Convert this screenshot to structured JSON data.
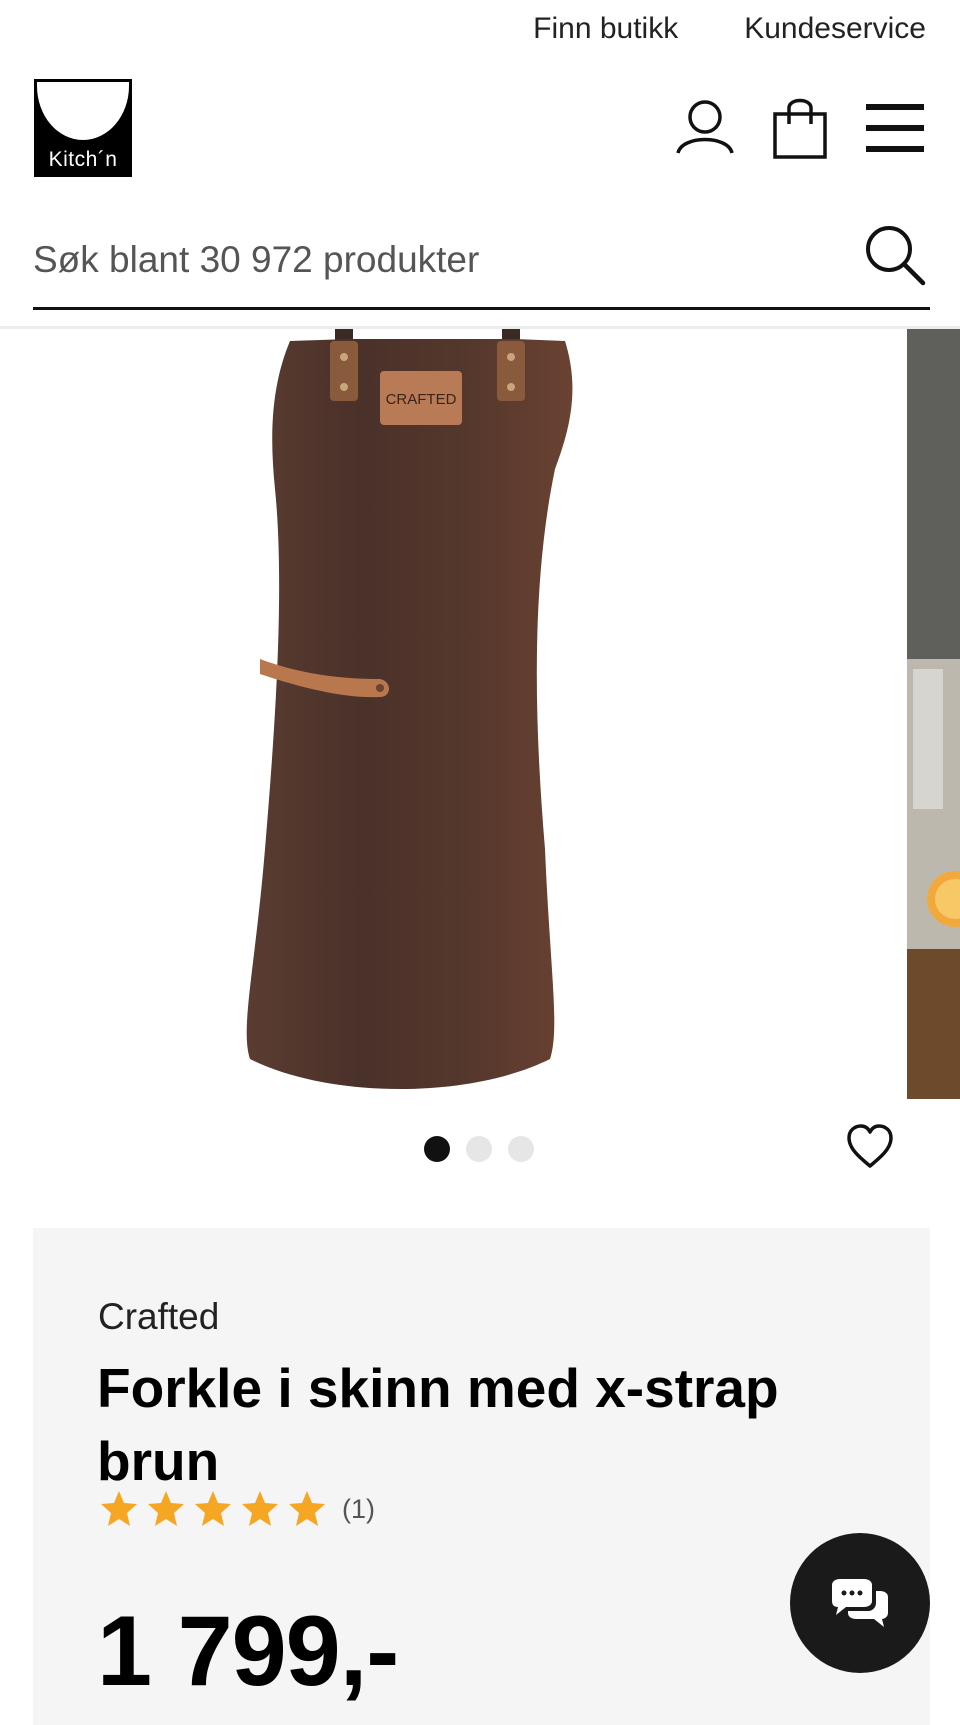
{
  "top_links": [
    "Finn butikk",
    "Kundeservice"
  ],
  "logo": {
    "text": "Kitch´n"
  },
  "header": {
    "icons": [
      "user-icon",
      "shopping-bag-icon",
      "menu-icon"
    ]
  },
  "search": {
    "placeholder": "Søk blant 30 972 produkter",
    "value": ""
  },
  "gallery": {
    "image_count": 3,
    "active_index": 0,
    "main_image": "leather-apron-image",
    "patch_text": "CRAFTED"
  },
  "product": {
    "brand": "Crafted",
    "title": "Forkle i skinn med x-strap brun",
    "rating": {
      "stars": 5,
      "max": 5,
      "count_label": "(1)"
    },
    "price": "1 799,-"
  },
  "colors": {
    "star": "#f5a623",
    "text": "#111111",
    "card_bg": "#f5f5f5",
    "chat_bg": "#1a1a1a"
  }
}
